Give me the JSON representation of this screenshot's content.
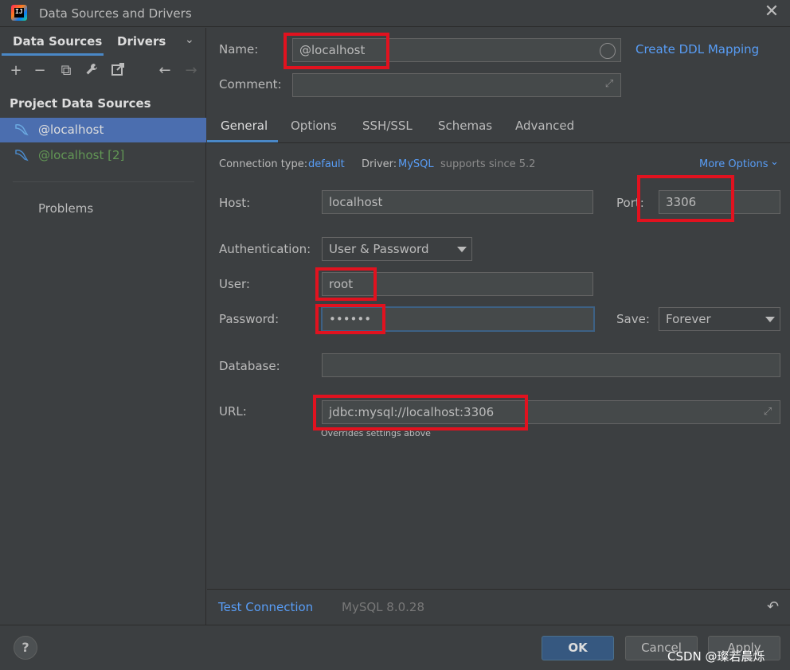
{
  "window": {
    "title": "Data Sources and Drivers",
    "close_glyph": "✕"
  },
  "left_panel": {
    "tabs": [
      {
        "label": "Data Sources"
      },
      {
        "label": "Drivers"
      }
    ],
    "tab_chevron": "⌄",
    "toolbar": [
      "+",
      "−",
      "⧉",
      "🔧",
      "↗",
      "←",
      "→"
    ],
    "section_title": "Project Data Sources",
    "items": [
      {
        "label": "@localhost",
        "icon": "mysql-dolphin-icon"
      },
      {
        "label": "@localhost [2]",
        "icon": "mysql-dolphin-icon"
      }
    ],
    "problems_label": "Problems"
  },
  "header": {
    "name_label": "Name:",
    "name_value": "@localhost",
    "create_ddl_link": "Create DDL Mapping",
    "comment_label": "Comment:",
    "comment_value": ""
  },
  "tabs": [
    {
      "label": "General"
    },
    {
      "label": "Options"
    },
    {
      "label": "SSH/SSL"
    },
    {
      "label": "Schemas"
    },
    {
      "label": "Advanced"
    }
  ],
  "connection_info": {
    "conn_type_label": "Connection type:",
    "conn_type_value": "default",
    "driver_label": "Driver:",
    "driver_value": "MySQL",
    "driver_note": "supports since 5.2",
    "more_options": "More Options"
  },
  "form": {
    "host_label": "Host:",
    "host_value": "localhost",
    "port_label": "Port:",
    "port_value": "3306",
    "auth_label": "Authentication:",
    "auth_value": "User & Password",
    "user_label": "User:",
    "user_value": "root",
    "password_label": "Password:",
    "password_value": "••••••",
    "save_label": "Save:",
    "save_value": "Forever",
    "database_label": "Database:",
    "database_value": "",
    "url_label": "URL:",
    "url_value": "jdbc:mysql://localhost:3306",
    "url_note": "Overrides settings above"
  },
  "bottom_bar": {
    "test_connection": "Test Connection",
    "version": "MySQL 8.0.28"
  },
  "footer": {
    "help": "?",
    "ok": "OK",
    "cancel": "Cancel",
    "apply": "Apply",
    "watermark": "CSDN @璨若晨烁"
  },
  "colors": {
    "accent": "#4a88c7",
    "link": "#589df6",
    "highlight_box": "#e1121f",
    "selection": "#4b6eaf",
    "secondary_item": "#629755"
  }
}
